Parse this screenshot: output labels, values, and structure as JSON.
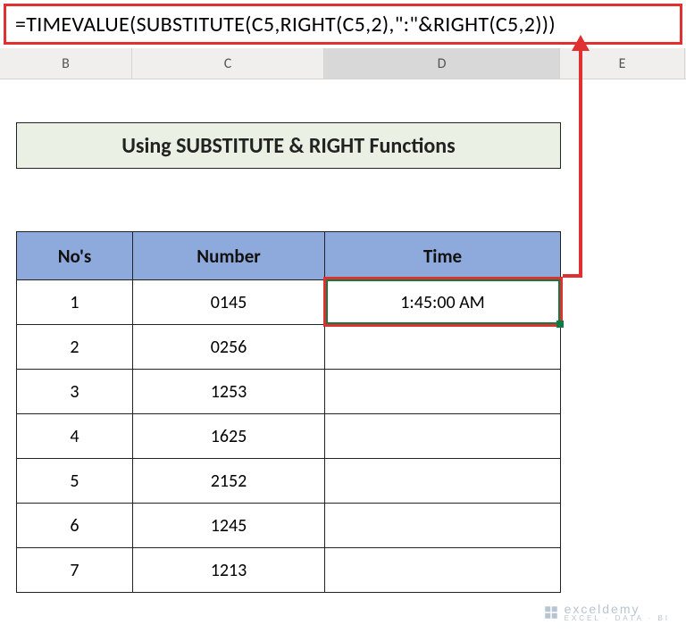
{
  "formula": "=TIMEVALUE(SUBSTITUTE(C5,RIGHT(C5,2),\":\"&RIGHT(C5,2)))",
  "columns": {
    "b": "B",
    "c": "C",
    "d": "D",
    "e": "E"
  },
  "title": "Using SUBSTITUTE & RIGHT Functions",
  "headers": {
    "nos": "No's",
    "number": "Number",
    "time": "Time"
  },
  "rows": [
    {
      "no": "1",
      "number": "0145",
      "time": "1:45:00 AM"
    },
    {
      "no": "2",
      "number": "0256",
      "time": ""
    },
    {
      "no": "3",
      "number": "1253",
      "time": ""
    },
    {
      "no": "4",
      "number": "1625",
      "time": ""
    },
    {
      "no": "5",
      "number": "2152",
      "time": ""
    },
    {
      "no": "6",
      "number": "1245",
      "time": ""
    },
    {
      "no": "7",
      "number": "1213",
      "time": ""
    }
  ],
  "watermark": {
    "brand": "exceldemy",
    "tag": "EXCEL · DATA · BI"
  },
  "chart_data": {
    "type": "table",
    "title": "Using SUBSTITUTE & RIGHT Functions",
    "columns": [
      "No's",
      "Number",
      "Time"
    ],
    "rows": [
      [
        "1",
        "0145",
        "1:45:00 AM"
      ],
      [
        "2",
        "0256",
        ""
      ],
      [
        "3",
        "1253",
        ""
      ],
      [
        "4",
        "1625",
        ""
      ],
      [
        "5",
        "2152",
        ""
      ],
      [
        "6",
        "1245",
        ""
      ],
      [
        "7",
        "1213",
        ""
      ]
    ],
    "formula_in_cell": "D5",
    "formula": "=TIMEVALUE(SUBSTITUTE(C5,RIGHT(C5,2),\":\"&RIGHT(C5,2)))"
  }
}
